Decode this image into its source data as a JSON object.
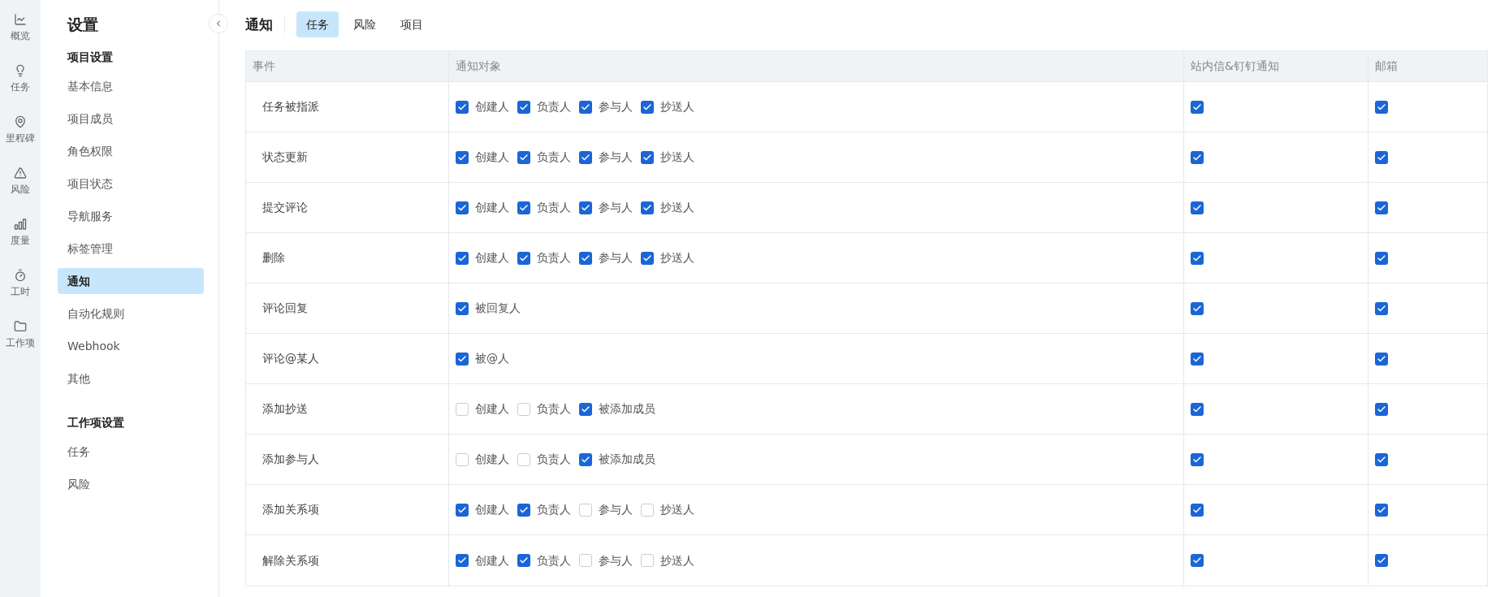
{
  "rail": [
    {
      "label": "概览"
    },
    {
      "label": "任务"
    },
    {
      "label": "里程碑"
    },
    {
      "label": "风险"
    },
    {
      "label": "度量"
    },
    {
      "label": "工时"
    },
    {
      "label": "工作项"
    }
  ],
  "sidebar": {
    "title": "设置",
    "groups": [
      {
        "heading": "项目设置",
        "items": [
          {
            "label": "基本信息",
            "selected": false
          },
          {
            "label": "项目成员",
            "selected": false
          },
          {
            "label": "角色权限",
            "selected": false
          },
          {
            "label": "项目状态",
            "selected": false
          },
          {
            "label": "导航服务",
            "selected": false
          },
          {
            "label": "标签管理",
            "selected": false
          },
          {
            "label": "通知",
            "selected": true
          },
          {
            "label": "自动化规则",
            "selected": false
          },
          {
            "label": "Webhook",
            "selected": false
          },
          {
            "label": "其他",
            "selected": false
          }
        ]
      },
      {
        "heading": "工作项设置",
        "items": [
          {
            "label": "任务",
            "selected": false
          },
          {
            "label": "风险",
            "selected": false
          }
        ]
      }
    ]
  },
  "header": {
    "title": "通知",
    "tabs": [
      {
        "label": "任务",
        "selected": true
      },
      {
        "label": "风险",
        "selected": false
      },
      {
        "label": "项目",
        "selected": false
      }
    ]
  },
  "table": {
    "columns": [
      "事件",
      "通知对象",
      "站内信&钉钉通知",
      "邮箱"
    ],
    "rows": [
      {
        "event": "任务被指派",
        "targets": [
          {
            "label": "创建人",
            "checked": true
          },
          {
            "label": "负责人",
            "checked": true
          },
          {
            "label": "参与人",
            "checked": true
          },
          {
            "label": "抄送人",
            "checked": true
          }
        ],
        "inbox": true,
        "email": true
      },
      {
        "event": "状态更新",
        "targets": [
          {
            "label": "创建人",
            "checked": true
          },
          {
            "label": "负责人",
            "checked": true
          },
          {
            "label": "参与人",
            "checked": true
          },
          {
            "label": "抄送人",
            "checked": true
          }
        ],
        "inbox": true,
        "email": true
      },
      {
        "event": "提交评论",
        "targets": [
          {
            "label": "创建人",
            "checked": true
          },
          {
            "label": "负责人",
            "checked": true
          },
          {
            "label": "参与人",
            "checked": true
          },
          {
            "label": "抄送人",
            "checked": true
          }
        ],
        "inbox": true,
        "email": true
      },
      {
        "event": "删除",
        "targets": [
          {
            "label": "创建人",
            "checked": true
          },
          {
            "label": "负责人",
            "checked": true
          },
          {
            "label": "参与人",
            "checked": true
          },
          {
            "label": "抄送人",
            "checked": true
          }
        ],
        "inbox": true,
        "email": true
      },
      {
        "event": "评论回复",
        "targets": [
          {
            "label": "被回复人",
            "checked": true
          }
        ],
        "inbox": true,
        "email": true
      },
      {
        "event": "评论@某人",
        "targets": [
          {
            "label": "被@人",
            "checked": true
          }
        ],
        "inbox": true,
        "email": true
      },
      {
        "event": "添加抄送",
        "targets": [
          {
            "label": "创建人",
            "checked": false
          },
          {
            "label": "负责人",
            "checked": false
          },
          {
            "label": "被添加成员",
            "checked": true
          }
        ],
        "inbox": true,
        "email": true
      },
      {
        "event": "添加参与人",
        "targets": [
          {
            "label": "创建人",
            "checked": false
          },
          {
            "label": "负责人",
            "checked": false
          },
          {
            "label": "被添加成员",
            "checked": true
          }
        ],
        "inbox": true,
        "email": true
      },
      {
        "event": "添加关系项",
        "targets": [
          {
            "label": "创建人",
            "checked": true
          },
          {
            "label": "负责人",
            "checked": true
          },
          {
            "label": "参与人",
            "checked": false
          },
          {
            "label": "抄送人",
            "checked": false
          }
        ],
        "inbox": true,
        "email": true
      },
      {
        "event": "解除关系项",
        "targets": [
          {
            "label": "创建人",
            "checked": true
          },
          {
            "label": "负责人",
            "checked": true
          },
          {
            "label": "参与人",
            "checked": false
          },
          {
            "label": "抄送人",
            "checked": false
          }
        ],
        "inbox": true,
        "email": true
      }
    ]
  }
}
